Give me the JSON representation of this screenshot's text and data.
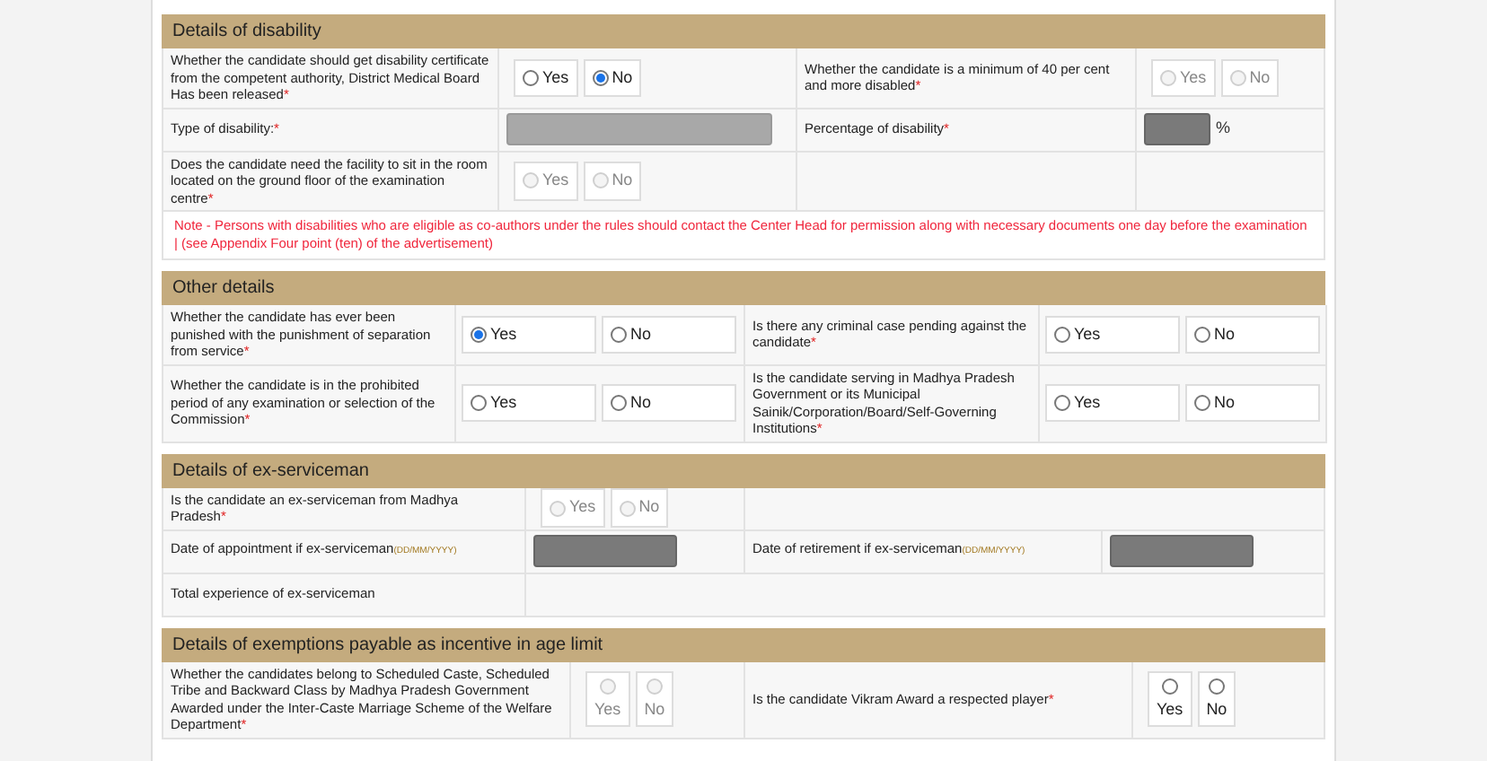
{
  "sections": [
    {
      "title": "Details of disability",
      "rows": [
        {
          "cells": [
            {
              "kind": "label",
              "text": "Whether the candidate should get disability certificate from the competent authority, District Medical Board\nHas been released",
              "mark": "*"
            },
            {
              "kind": "radio",
              "disabled": false,
              "options": [
                {
                  "label": "Yes",
                  "selected": false
                },
                {
                  "label": "No",
                  "selected": true
                }
              ]
            },
            {
              "kind": "label",
              "text": "Whether the candidate is a minimum of 40 per cent and more disabled",
              "mark": "*"
            },
            {
              "kind": "radio",
              "disabled": true,
              "options": [
                {
                  "label": "Yes",
                  "selected": false
                },
                {
                  "label": "No",
                  "selected": false
                }
              ]
            }
          ]
        },
        {
          "cells": [
            {
              "kind": "label",
              "text": "Type of disability:",
              "mark": "*"
            },
            {
              "kind": "input",
              "disabled": true
            },
            {
              "kind": "label",
              "text": "Percentage of disability",
              "mark": "*"
            },
            {
              "kind": "input_short",
              "disabled": true,
              "suffix": "%"
            }
          ]
        },
        {
          "cells": [
            {
              "kind": "label",
              "text": "Does the candidate need the facility to sit in the room located on the ground floor of the examination centre",
              "mark": "*"
            },
            {
              "kind": "radio",
              "disabled": true,
              "options": [
                {
                  "label": "Yes",
                  "selected": false
                },
                {
                  "label": "No",
                  "selected": false
                }
              ]
            },
            {
              "kind": "empty"
            },
            {
              "kind": "empty"
            }
          ]
        },
        {
          "cells": [
            {
              "kind": "note",
              "text": "Note - Persons with disabilities who are eligible as co-authors under the rules should contact the Center Head for permission along with necessary documents one day before the examination | (see Appendix Four point (ten) of the advertisement)"
            }
          ]
        }
      ]
    },
    {
      "title": "Other details",
      "rows": [
        {
          "cells": [
            {
              "kind": "label",
              "text": "Whether the candidate has ever been punished with the punishment of separation from service",
              "mark": "*"
            },
            {
              "kind": "radio_wide",
              "disabled": false,
              "options": [
                {
                  "label": "Yes",
                  "selected": true
                },
                {
                  "label": "No",
                  "selected": false
                }
              ]
            },
            {
              "kind": "label",
              "text": "Is there any criminal case pending against the candidate",
              "mark": "*"
            },
            {
              "kind": "radio_wide",
              "disabled": false,
              "options": [
                {
                  "label": "Yes",
                  "selected": false
                },
                {
                  "label": "No",
                  "selected": false
                }
              ]
            }
          ]
        },
        {
          "cells": [
            {
              "kind": "label",
              "text": "Whether the candidate is in the prohibited period of any examination or selection of the Commission",
              "mark": "*"
            },
            {
              "kind": "radio_wide",
              "disabled": false,
              "options": [
                {
                  "label": "Yes",
                  "selected": false
                },
                {
                  "label": "No",
                  "selected": false
                }
              ]
            },
            {
              "kind": "label",
              "text": "Is the candidate serving in Madhya Pradesh Government or its Municipal Sainik/Corporation/Board/Self-Governing Institutions",
              "mark": "*"
            },
            {
              "kind": "radio_wide",
              "disabled": false,
              "options": [
                {
                  "label": "Yes",
                  "selected": false
                },
                {
                  "label": "No",
                  "selected": false
                }
              ]
            }
          ]
        }
      ]
    },
    {
      "title": "Details of ex-serviceman",
      "rows": [
        {
          "cells": [
            {
              "kind": "label",
              "text": "Is the candidate an ex-serviceman from Madhya Pradesh",
              "mark": "*"
            },
            {
              "kind": "radio",
              "disabled": true,
              "options": [
                {
                  "label": "Yes",
                  "selected": false
                },
                {
                  "label": "No",
                  "selected": false
                }
              ]
            },
            {
              "kind": "empty"
            }
          ]
        },
        {
          "cells": [
            {
              "kind": "label",
              "text": "Date of appointment if ex-serviceman",
              "hint": "(DD/MM/YYYY)"
            },
            {
              "kind": "input_date",
              "disabled": true
            },
            {
              "kind": "label",
              "text": "Date of retirement if ex-serviceman",
              "hint": "(DD/MM/YYYY)"
            },
            {
              "kind": "input_date",
              "disabled": true
            }
          ]
        },
        {
          "cells": [
            {
              "kind": "label",
              "text": "Total experience of ex-serviceman"
            },
            {
              "kind": "empty"
            }
          ]
        }
      ]
    },
    {
      "title": "Details of exemptions payable as incentive in age limit",
      "rows": [
        {
          "cells": [
            {
              "kind": "label",
              "text": "Whether the candidates belong to Scheduled Caste, Scheduled Tribe and Backward Class by Madhya Pradesh Government\nAwarded under the Inter-Caste Marriage Scheme of the Welfare Department",
              "mark": "*"
            },
            {
              "kind": "radio_stacked",
              "disabled": true,
              "options": [
                {
                  "label": "Yes",
                  "selected": false
                },
                {
                  "label": "No",
                  "selected": false
                }
              ]
            },
            {
              "kind": "label",
              "text": "Is the candidate Vikram Award a respected player",
              "mark": "*"
            },
            {
              "kind": "radio_stacked",
              "disabled": false,
              "options": [
                {
                  "label": "Yes",
                  "selected": false
                },
                {
                  "label": "No",
                  "selected": false
                }
              ]
            }
          ]
        }
      ]
    }
  ]
}
